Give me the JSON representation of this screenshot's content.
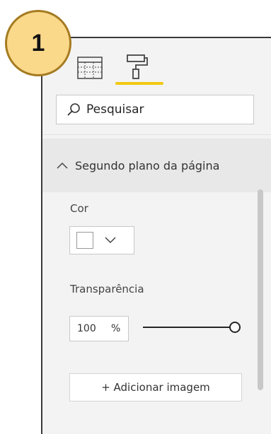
{
  "badge": {
    "number": "1"
  },
  "tabs": [
    {
      "icon": "fields-table-icon"
    },
    {
      "icon": "paint-roller-icon",
      "active": true
    }
  ],
  "search": {
    "placeholder": "Pesquisar"
  },
  "section": {
    "title": "Segundo plano da página",
    "expanded": true,
    "color": {
      "label": "Cor",
      "value": "#ffffff"
    },
    "transparency": {
      "label": "Transparência",
      "value": "100",
      "unit": "%",
      "level": 1.0
    },
    "add_image_label": "+ Adicionar imagem"
  },
  "colors": {
    "accent": "#f2c811",
    "badge_fill": "#fbd98b",
    "badge_border": "#a57b21"
  }
}
